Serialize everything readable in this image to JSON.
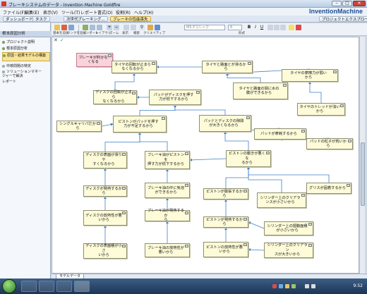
{
  "window": {
    "title": "ブレーキシステムのデータ - Invention Machine Goldfire",
    "brand": "InventionMachine"
  },
  "menu": [
    "ファイル(F)",
    "編集(E)",
    "表示(V)",
    "ツール(T)",
    "レポート",
    "書式(O)",
    "役割(R)",
    "ヘルプ(H)"
  ],
  "tabs": {
    "dashboard": "ダッシュボード",
    "task": "タスク",
    "next_gen": "次世代ブレーキング...",
    "brake_loss": "ブレーキの性能喪失",
    "project": "プロジェクトエクスプローラ"
  },
  "sidebar": {
    "header": "根本原因分析",
    "items": [
      {
        "label": "プロジェクト説明",
        "active": false
      },
      {
        "label": "根本原因分析",
        "active": false
      },
      {
        "label": "原因・結果モデルの構築",
        "active": true
      },
      {
        "label": "中核問題の特定",
        "active": false
      },
      {
        "label": "ソリューションマネージャーで解決",
        "active": false
      },
      {
        "label": "レポート",
        "active": false
      }
    ]
  },
  "toolbar": {
    "labels": [
      "基本を追加",
      "リンクを追加",
      "インポート",
      "レイアウト",
      "ズーム",
      "表示",
      "検索",
      "クリエイティブ"
    ],
    "font_name": "MS Pゴシック",
    "font_size": "8",
    "format_label": "形式"
  },
  "nodes": [
    {
      "id": "n1",
      "text": "ブレーキが利かなくなる",
      "pink": true
    },
    {
      "id": "n2",
      "text": "タイヤの回転が止まら\nなくなるから"
    },
    {
      "id": "n3",
      "text": "タイヤと路面とが滑るか\nら"
    },
    {
      "id": "n4",
      "text": "タイヤの摩擦力が弱い\nから"
    },
    {
      "id": "n5",
      "text": "タイヤと路面の間に水の\n膜ができるから"
    },
    {
      "id": "n6",
      "text": "ディスクの回転が止まら\nなくなるから"
    },
    {
      "id": "n7",
      "text": "パッドがディスクを押す\n力が低下するから"
    },
    {
      "id": "n8",
      "text": "タイヤのトレッドが浅い\nから"
    },
    {
      "id": "n9",
      "text": "シングルキャリパだから"
    },
    {
      "id": "n10",
      "text": "ピストンがパッドを押す\n力が不足するから"
    },
    {
      "id": "n11",
      "text": "パッドとディスクの隙間\nが大きくなるから"
    },
    {
      "id": "n12",
      "text": "パッドが摩耗するから"
    },
    {
      "id": "n13",
      "text": "パッドの粒子が荒いか\nら"
    },
    {
      "id": "n14",
      "text": "ディスクの表面が滑りや\nすくなるから"
    },
    {
      "id": "n15",
      "text": "ブレーキ油がピストンを\n押す力が低下するから"
    },
    {
      "id": "n16",
      "text": "ピストンの動きが悪くな\nるから"
    },
    {
      "id": "n17",
      "text": "ディスクが発熱するから"
    },
    {
      "id": "n18",
      "text": "ブレーキ油の中に気泡\nができるから"
    },
    {
      "id": "n19",
      "text": "ピストンが膨張するから"
    },
    {
      "id": "n20",
      "text": "シリンダー上のクリアラ\nンスが小さいから"
    },
    {
      "id": "n21",
      "text": "グリスが固着するから"
    },
    {
      "id": "n22",
      "text": "ディスクの放熱性が悪\nいから"
    },
    {
      "id": "n23",
      "text": "ブレーキ油が発熱するか\nら"
    },
    {
      "id": "n24",
      "text": "ピストンが発熱するから"
    },
    {
      "id": "n25",
      "text": "シリンダー上の摺動面積\nが小さいから"
    },
    {
      "id": "n26",
      "text": "ディスクの表面積が小さ\nいから"
    },
    {
      "id": "n27",
      "text": "ブレーキ油の放熱性が\n悪いから"
    },
    {
      "id": "n28",
      "text": "ピストンの放熱性が悪\nいから"
    },
    {
      "id": "n29",
      "text": "シリンダー上のクリアラン\nスが大きいから"
    }
  ],
  "status": {
    "sheet_tab": "モデルデータ"
  },
  "taskbar": {
    "clock": "9:52"
  },
  "colors": {
    "node_fill": "#fdfbd8",
    "problem_fill": "#f9d3dc",
    "link": "#3d7fc9",
    "accent": "#1d4f91"
  }
}
